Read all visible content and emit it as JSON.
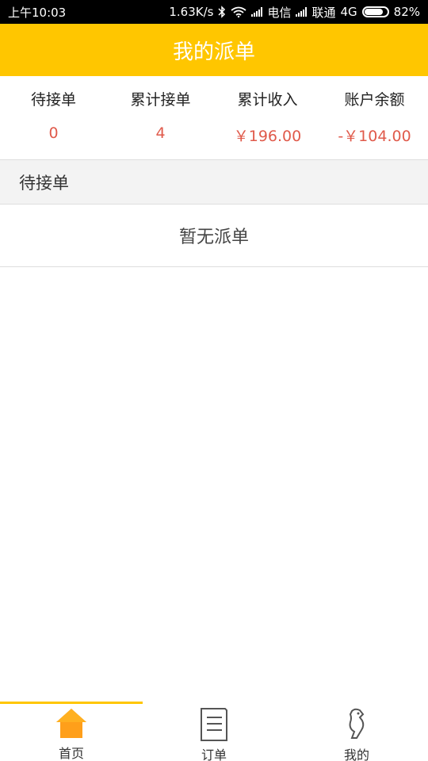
{
  "status_bar": {
    "time": "上午10:03",
    "speed": "1.63K/s",
    "carrier1": "电信",
    "carrier2": "联通",
    "network": "4G",
    "battery": "82%",
    "battery_level": 0.82,
    "icons": [
      "bluetooth-icon",
      "wifi-icon",
      "signal-icon",
      "battery-icon"
    ]
  },
  "header": {
    "title": "我的派单"
  },
  "stats": [
    {
      "label": "待接单",
      "value": "0"
    },
    {
      "label": "累计接单",
      "value": "4"
    },
    {
      "label": "累计收入",
      "value": "￥196.00"
    },
    {
      "label": "账户余额",
      "value": "-￥104.00"
    }
  ],
  "section": {
    "title": "待接单",
    "empty_text": "暂无派单"
  },
  "tabs": [
    {
      "label": "首页",
      "icon": "home-icon",
      "active": true
    },
    {
      "label": "订单",
      "icon": "order-list-icon",
      "active": false
    },
    {
      "label": "我的",
      "icon": "profile-icon",
      "active": false
    }
  ],
  "colors": {
    "accent": "#ffc600",
    "value_red": "#e05a4b",
    "section_bg": "#f3f3f3"
  }
}
